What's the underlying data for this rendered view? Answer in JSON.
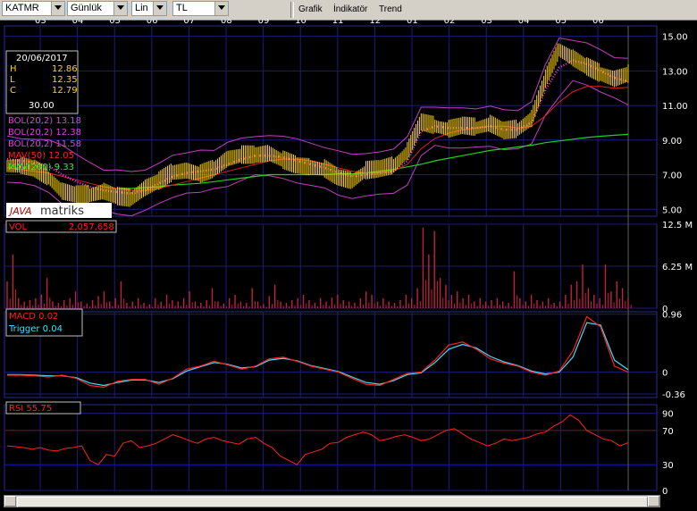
{
  "toolbar": {
    "symbol": "KATMR",
    "period": "Günlük",
    "scale": "Lin",
    "currency": "TL",
    "menu": [
      "Grafik",
      "İndikatör",
      "Trend"
    ]
  },
  "info_box": {
    "date": "20/06/2017",
    "h_label": "H",
    "h_value": "12.86",
    "l_label": "L",
    "l_value": "12.35",
    "c_label": "C",
    "c_value": "12.79",
    "v_value": "30.00"
  },
  "logo": {
    "text_left": "JAVA",
    "text_right": "matriks"
  },
  "legends": {
    "price": [
      {
        "text": "BOL(20,2) 13.18",
        "color": "#e040e0"
      },
      {
        "text": "BOL(20,2) 12.38",
        "color": "#e040e0"
      },
      {
        "text": "BOL(20,2) 11.58",
        "color": "#e040e0"
      },
      {
        "text": "MAV(50) 12.05",
        "color": "#ff2020"
      },
      {
        "text": "MAV(200) 9.33",
        "color": "#20ff20"
      }
    ],
    "volume": {
      "label": "VOL",
      "value": "2,057,658"
    },
    "macd": [
      {
        "text": "MACD 0.02",
        "color": "#ff2020"
      },
      {
        "text": "Trigger 0.04",
        "color": "#40e0ff"
      }
    ],
    "rsi": {
      "text": "RSI 55.75",
      "color": "#ff2020"
    }
  },
  "colors": {
    "grid": "#1c1c7a",
    "price": "#ffd400",
    "bollinger": "#c040c0",
    "mav50": "#e02020",
    "mav200": "#20d020",
    "volume": "#c02040",
    "macd": "#ff2020",
    "trigger": "#40e0ff",
    "rsi": "#ff2020"
  },
  "chart_data": [
    {
      "type": "line",
      "title": "KATMR",
      "x": [
        "03",
        "04",
        "05",
        "06",
        "07",
        "08",
        "09",
        "10",
        "11",
        "12",
        "01",
        "02",
        "03",
        "04",
        "05",
        "06"
      ],
      "yticks": [
        "15.00",
        "13.00",
        "11.00",
        "9.00",
        "7.00",
        "5.00"
      ],
      "ylim": [
        4.6,
        15.6
      ],
      "series": [
        {
          "name": "Close",
          "values": [
            7.5,
            7.5,
            7.3,
            6.8,
            6.0,
            5.8,
            5.8,
            6.0,
            5.7,
            5.6,
            6.2,
            6.6,
            7.1,
            7.2,
            7.0,
            7.3,
            7.9,
            8.1,
            8.1,
            8.2,
            7.8,
            7.5,
            7.4,
            7.3,
            6.8,
            6.6,
            7.2,
            7.3,
            7.5,
            8.3,
            10.0,
            9.8,
            9.6,
            9.8,
            9.7,
            9.9,
            9.5,
            9.6,
            10.2,
            12.5,
            14.2,
            13.7,
            13.2,
            12.8,
            12.5,
            12.79
          ]
        },
        {
          "name": "BOL(20,2)",
          "values": [
            7.9,
            7.8,
            7.7,
            7.5,
            7.0,
            6.6,
            6.3,
            6.1,
            6.0,
            5.9,
            6.1,
            6.5,
            6.9,
            7.1,
            7.2,
            7.3,
            7.6,
            7.9,
            8.1,
            8.1,
            8.0,
            7.8,
            7.6,
            7.4,
            7.1,
            6.9,
            7.0,
            7.1,
            7.2,
            7.8,
            9.5,
            9.8,
            9.7,
            9.7,
            9.7,
            9.8,
            9.6,
            9.6,
            10.0,
            11.9,
            13.2,
            13.6,
            13.4,
            13.0,
            12.6,
            12.38
          ]
        },
        {
          "name": "MAV(50)",
          "values": [
            7.4,
            7.3,
            7.2,
            7.1,
            6.9,
            6.7,
            6.5,
            6.3,
            6.2,
            6.1,
            6.1,
            6.2,
            6.4,
            6.6,
            6.8,
            7.0,
            7.2,
            7.4,
            7.6,
            7.8,
            7.9,
            7.9,
            7.8,
            7.6,
            7.4,
            7.2,
            7.1,
            7.1,
            7.2,
            7.6,
            8.5,
            9.1,
            9.4,
            9.6,
            9.7,
            9.8,
            9.8,
            9.7,
            9.8,
            10.4,
            11.2,
            11.8,
            12.1,
            12.1,
            12.0,
            12.05
          ]
        },
        {
          "name": "MAV(200)",
          "values": [
            null,
            null,
            null,
            null,
            null,
            null,
            null,
            null,
            6.2,
            6.2,
            6.25,
            6.3,
            6.4,
            6.45,
            6.5,
            6.6,
            6.7,
            6.8,
            6.9,
            7.0,
            7.0,
            7.0,
            7.0,
            7.0,
            7.05,
            7.05,
            7.1,
            7.2,
            7.3,
            7.45,
            7.6,
            7.8,
            7.95,
            8.1,
            8.25,
            8.4,
            8.5,
            8.6,
            8.7,
            8.85,
            8.95,
            9.05,
            9.15,
            9.22,
            9.28,
            9.33
          ]
        }
      ]
    },
    {
      "type": "bar",
      "title": "VOL",
      "yticks": [
        "12.5 M",
        "6.25 M",
        "0"
      ],
      "ylim": [
        0,
        12.5
      ],
      "values": [
        4.0,
        8.0,
        1.5,
        1.0,
        1.2,
        1.5,
        2.0,
        4.5,
        1.0,
        0.8,
        1.2,
        1.5,
        2.5,
        1.0,
        0.7,
        1.2,
        1.8,
        2.5,
        1.0,
        1.5,
        4.0,
        0.8,
        1.0,
        1.5,
        0.8,
        0.6,
        1.5,
        1.0,
        2.0,
        1.2,
        1.0,
        1.5,
        2.5,
        1.0,
        0.8,
        1.2,
        3.0,
        1.0,
        0.7,
        1.5,
        2.0,
        1.0,
        0.8,
        3.0,
        1.0,
        0.6,
        1.8,
        3.5,
        1.0,
        0.8,
        1.2,
        1.5,
        2.0,
        1.2,
        0.8,
        1.5,
        1.0,
        1.6,
        2.0,
        1.2,
        1.0,
        0.8,
        1.5,
        2.5,
        2.0,
        1.0,
        1.5,
        1.0,
        0.8,
        1.2,
        2.0,
        1.5,
        3.0,
        12.0,
        8.0,
        11.5,
        4.5,
        3.5,
        2.0,
        2.5,
        1.5,
        2.0,
        1.0,
        1.5,
        1.0,
        1.2,
        1.5,
        1.0,
        0.8,
        5.5,
        1.5,
        1.0,
        2.0,
        1.2,
        1.0,
        1.5,
        0.8,
        1.0,
        2.0,
        3.5,
        4.0,
        6.5,
        3.0,
        2.0,
        1.5,
        6.5,
        2.5,
        4.0,
        3.0,
        1.5
      ]
    },
    {
      "type": "line",
      "title": "MACD",
      "yticks": [
        "0.96",
        "0",
        "-0.36"
      ],
      "ylim": [
        -0.42,
        1.0
      ],
      "series": [
        {
          "name": "MACD",
          "values": [
            -0.05,
            -0.05,
            -0.06,
            -0.08,
            -0.05,
            -0.1,
            -0.22,
            -0.25,
            -0.15,
            -0.12,
            -0.12,
            -0.2,
            -0.1,
            0.05,
            0.1,
            0.18,
            0.12,
            0.05,
            0.1,
            0.22,
            0.25,
            0.18,
            0.1,
            0.05,
            0.0,
            -0.1,
            -0.2,
            -0.22,
            -0.12,
            -0.02,
            0.0,
            0.2,
            0.45,
            0.5,
            0.38,
            0.22,
            0.15,
            0.1,
            0.0,
            -0.05,
            0.02,
            0.35,
            0.92,
            0.75,
            0.1,
            0.0
          ]
        },
        {
          "name": "Trigger",
          "values": [
            -0.04,
            -0.04,
            -0.05,
            -0.06,
            -0.06,
            -0.09,
            -0.18,
            -0.22,
            -0.17,
            -0.13,
            -0.13,
            -0.17,
            -0.11,
            0.02,
            0.09,
            0.16,
            0.13,
            0.07,
            0.09,
            0.2,
            0.23,
            0.19,
            0.11,
            0.06,
            0.01,
            -0.08,
            -0.17,
            -0.2,
            -0.14,
            -0.04,
            -0.01,
            0.16,
            0.38,
            0.46,
            0.4,
            0.26,
            0.17,
            0.11,
            0.02,
            -0.03,
            0.0,
            0.25,
            0.82,
            0.78,
            0.2,
            0.04
          ]
        }
      ]
    },
    {
      "type": "line",
      "title": "RSI",
      "yticks": [
        "90",
        "70",
        "30",
        "0"
      ],
      "ylim": [
        0,
        100
      ],
      "series": [
        {
          "name": "RSI",
          "values": [
            52,
            51,
            50,
            48,
            50,
            47,
            46,
            49,
            50,
            52,
            35,
            30,
            42,
            40,
            55,
            58,
            50,
            52,
            55,
            60,
            65,
            62,
            58,
            55,
            60,
            62,
            58,
            56,
            54,
            60,
            62,
            55,
            50,
            40,
            35,
            30,
            42,
            45,
            48,
            55,
            56,
            62,
            65,
            68,
            65,
            58,
            60,
            63,
            65,
            62,
            58,
            60,
            65,
            70,
            72,
            66,
            60,
            56,
            52,
            55,
            60,
            58,
            60,
            62,
            66,
            68,
            75,
            80,
            88,
            82,
            70,
            65,
            60,
            58,
            52,
            55.75
          ]
        }
      ]
    }
  ]
}
